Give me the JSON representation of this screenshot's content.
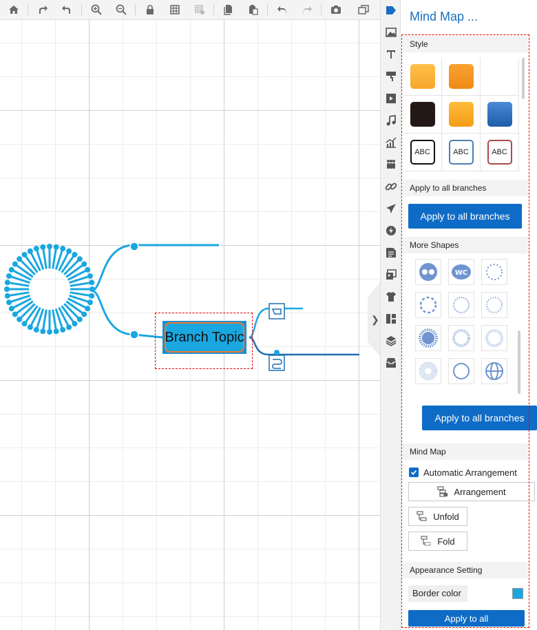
{
  "panel": {
    "title": "Mind Map ...",
    "sections": {
      "style": "Style",
      "apply_all_branches_head": "Apply to all branches",
      "more_shapes": "More Shapes",
      "mind_map": "Mind Map",
      "appearance": "Appearance Setting"
    },
    "apply_all_branches_button": "Apply to all branches",
    "apply_all_branches_button_2": "Apply to all branches",
    "auto_arrangement": "Automatic Arrangement",
    "arrangement_button": "Arrangement",
    "unfold_button": "Unfold",
    "fold_button": "Fold",
    "border_color_label": "Border color",
    "apply_to_all_button": "Apply to all",
    "style_abc": "ABC"
  },
  "canvas": {
    "topic_text": "Branch Topic"
  },
  "colors": {
    "accent": "#0f6cc6",
    "branch_line": "#1aa7e0",
    "selection": "#e00000",
    "border_color_value": "#1aa7e0"
  }
}
